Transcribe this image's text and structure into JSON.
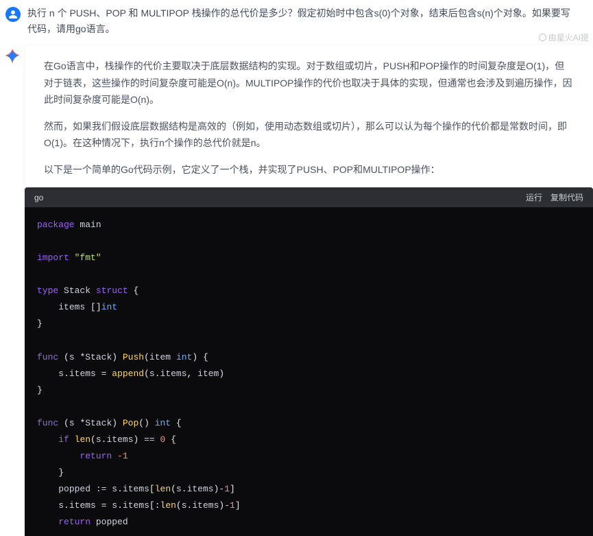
{
  "question": "执行 n 个 PUSH、POP 和 MULTIPOP 栈操作的总代价是多少？假定初始时中包含s(0)个对象，结束后包含s(n)个对象。如果要写代码，请用go语言。",
  "powered_by": "由星火AI提",
  "paragraphs": [
    "在Go语言中，栈操作的代价主要取决于底层数据结构的实现。对于数组或切片，PUSH和POP操作的时间复杂度是O(1)，但对于链表，这些操作的时间复杂度可能是O(n)。MULTIPOP操作的代价也取决于具体的实现，但通常也会涉及到遍历操作，因此时间复杂度可能是O(n)。",
    "然而，如果我们假设底层数据结构是高效的（例如，使用动态数组或切片），那么可以认为每个操作的代价都是常数时间，即O(1)。在这种情况下，执行n个操作的总代价就是n。",
    "以下是一个简单的Go代码示例，它定义了一个栈，并实现了PUSH、POP和MULTIPOP操作："
  ],
  "code": {
    "lang": "go",
    "action_run": "运行",
    "action_copy": "复制代码"
  }
}
